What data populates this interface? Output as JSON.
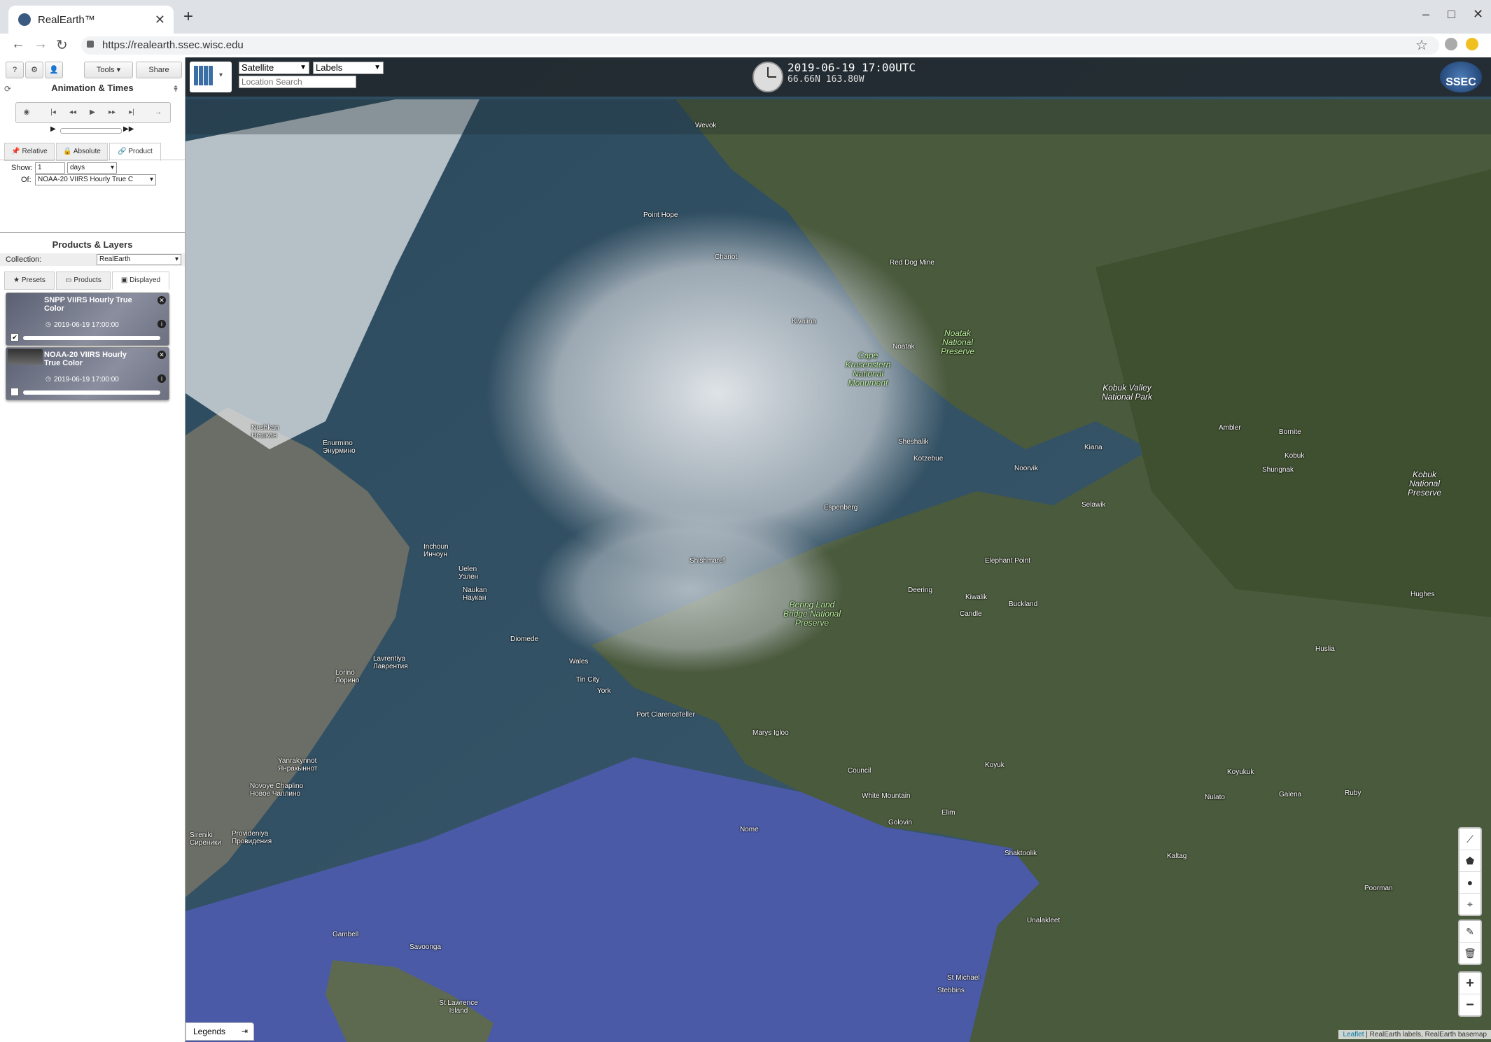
{
  "browser": {
    "tab_title": "RealEarth™",
    "url": "https://realearth.ssec.wisc.edu"
  },
  "sidebar": {
    "tool_buttons": [
      "?",
      "⚙",
      "👤",
      "Tools",
      "Share"
    ],
    "animation": {
      "title": "Animation & Times",
      "modes": [
        "Relative",
        "Absolute",
        "Product"
      ],
      "active_mode": "Product",
      "show_label": "Show:",
      "show_value": "1",
      "unit_select": "days",
      "of_label": "Of:",
      "of_select": "NOAA-20 VIIRS Hourly True C"
    },
    "layers": {
      "title": "Products & Layers",
      "collection_label": "Collection:",
      "collection_value": "RealEarth",
      "tabs": [
        "Presets",
        "Products",
        "Displayed"
      ],
      "active_tab": "Displayed",
      "cards": [
        {
          "title": "SNPP VIIRS Hourly True Color",
          "date": "2019-06-19 17:00:00",
          "checked": true
        },
        {
          "title": "NOAA-20 VIIRS Hourly True Color",
          "date": "2019-06-19 17:00:00",
          "checked": false
        }
      ]
    }
  },
  "map": {
    "base_select": "Satellite",
    "labels_select": "Labels",
    "search_placeholder": "Location Search",
    "datetime": "2019-06-19 17:00UTC",
    "coords": "66.66N 163.80W",
    "logo": "SSEC",
    "legends_label": "Legends",
    "attribution_link": "Leaflet",
    "attribution_text": "| RealEarth labels, RealEarth basemap",
    "zoom_in": "+",
    "zoom_out": "−",
    "places": [
      "Wevok",
      "Point Hope",
      "Chariot",
      "Red Dog Mine",
      "Kivalina",
      "Noatak",
      "Noatak National Preserve",
      "Cape Krusenstern National Monument",
      "Kobuk Valley National Park",
      "Sheshalik",
      "Kotzebue",
      "Kiana",
      "Ambler",
      "Bornite",
      "Kobuk",
      "Shungnak",
      "Kobuk National Preserve",
      "Noorvik",
      "Selawik",
      "Espenberg",
      "Shishmaref",
      "Elephant Point",
      "Deering",
      "Kiwalik",
      "Candle",
      "Buckland",
      "Bering Land Bridge National Preserve",
      "Neshkan\nНешкан",
      "Enurmino\nЭнурмино",
      "Inchoun\nИнчоун",
      "Uelen\nУэлен",
      "Naukan\nНаукан",
      "Diomede",
      "Wales",
      "Tin City",
      "York",
      "Port Clarence",
      "Teller",
      "Marys Igloo",
      "Council",
      "White Mountain",
      "Golovin",
      "Elim",
      "Koyuk",
      "Nome",
      "Lavrentiya\nЛаврентия",
      "Lorino\nЛорино",
      "Yanrakynnot\nЯнракыннот",
      "Novoye Chaplino\nНовое Чаплино",
      "Sireniki\nСиреники",
      "Provideniya\nПровидения",
      "Gambell",
      "Savoonga",
      "St Lawrence Island",
      "St Michael",
      "Stebbins",
      "Unalakleet",
      "Shaktoolik",
      "Kaltag",
      "Nulato",
      "Koyukuk",
      "Galena",
      "Ruby",
      "Poorman",
      "Huslia",
      "Hughes"
    ]
  }
}
